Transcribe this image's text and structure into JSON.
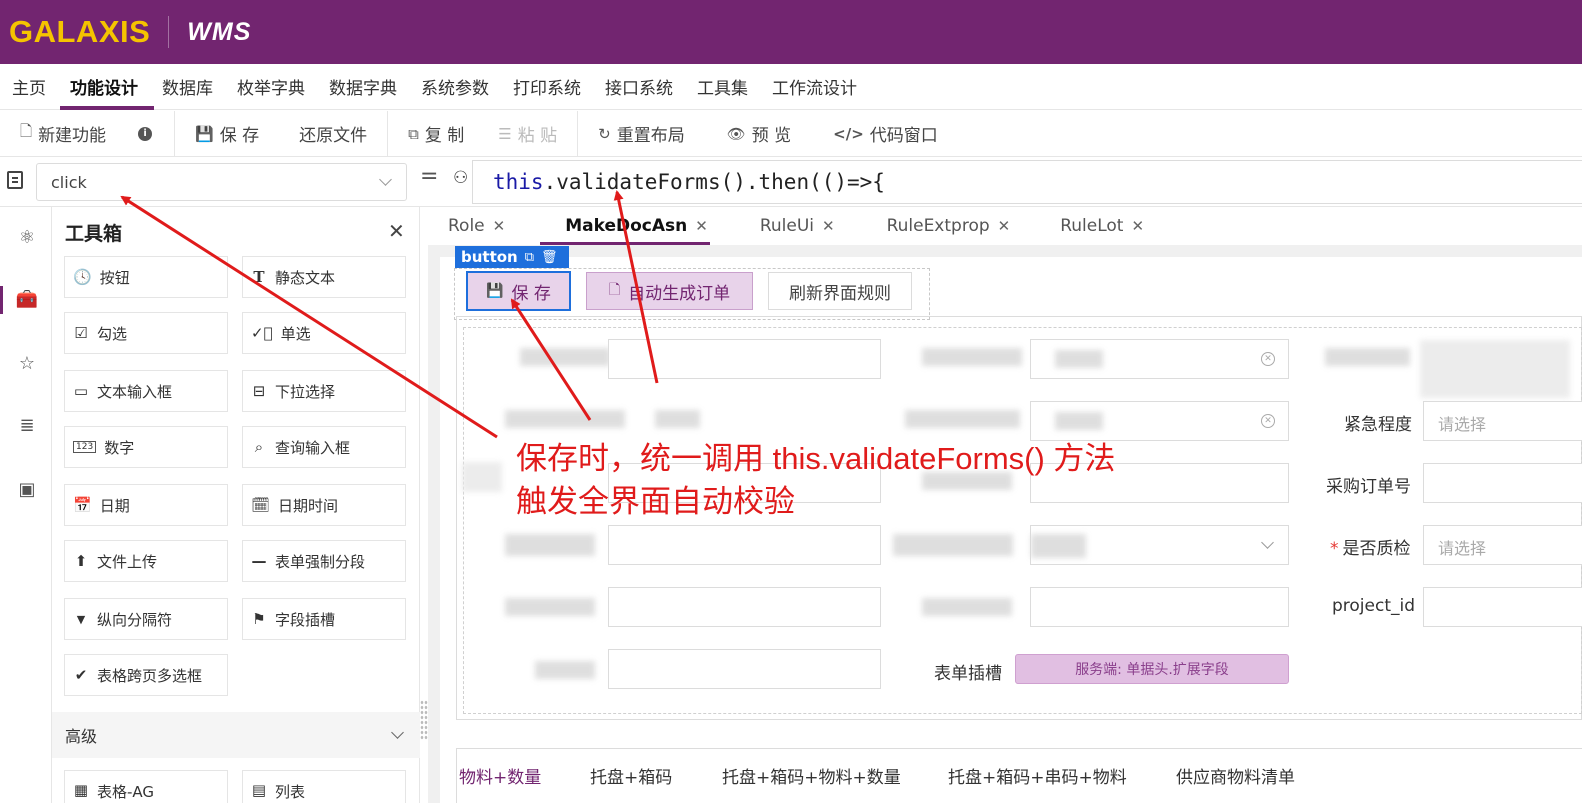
{
  "app": {
    "brand": "GALAXIS",
    "product": "WMS"
  },
  "menu": [
    {
      "label": "主页",
      "active": false
    },
    {
      "label": "功能设计",
      "active": true
    },
    {
      "label": "数据库",
      "active": false
    },
    {
      "label": "枚举字典",
      "active": false
    },
    {
      "label": "数据字典",
      "active": false
    },
    {
      "label": "系统参数",
      "active": false
    },
    {
      "label": "打印系统",
      "active": false
    },
    {
      "label": "接口系统",
      "active": false
    },
    {
      "label": "工具集",
      "active": false
    },
    {
      "label": "工作流设计",
      "active": false
    }
  ],
  "toolbar": {
    "new_function": "新建功能",
    "save": "保 存",
    "restore_file": "还原文件",
    "copy": "复 制",
    "paste": "粘 贴",
    "reset_layout": "重置布局",
    "preview": "预 览",
    "code_window": "代码窗口"
  },
  "event_bar": {
    "event_value": "click",
    "code_keyword": "this",
    "code_rest": ".validateForms().then(()=>{"
  },
  "toolbox": {
    "title": "工具箱",
    "widgets": [
      {
        "label": "按钮",
        "icon": "clock-icon"
      },
      {
        "label": "静态文本",
        "icon": "text-icon"
      },
      {
        "label": "勾选",
        "icon": "checkbox-icon"
      },
      {
        "label": "单选",
        "icon": "radio-icon"
      },
      {
        "label": "文本输入框",
        "icon": "text-input-icon"
      },
      {
        "label": "下拉选择",
        "icon": "select-icon"
      },
      {
        "label": "数字",
        "icon": "number-icon"
      },
      {
        "label": "查询输入框",
        "icon": "search-input-icon"
      },
      {
        "label": "日期",
        "icon": "calendar-icon"
      },
      {
        "label": "日期时间",
        "icon": "datetime-icon"
      },
      {
        "label": "文件上传",
        "icon": "upload-icon"
      },
      {
        "label": "表单强制分段",
        "icon": "dash-icon"
      },
      {
        "label": "纵向分隔符",
        "icon": "caret-down-icon"
      },
      {
        "label": "字段插槽",
        "icon": "flag-icon"
      },
      {
        "label": "表格跨页多选框",
        "icon": "double-check-icon"
      }
    ],
    "advanced_section": "高级",
    "advanced_widgets": [
      {
        "label": "表格-AG",
        "icon": "table-icon"
      },
      {
        "label": "列表",
        "icon": "list-icon"
      }
    ]
  },
  "tabs": [
    {
      "label": "Role",
      "active": false
    },
    {
      "label": "MakeDocAsn",
      "active": true
    },
    {
      "label": "RuleUi",
      "active": false
    },
    {
      "label": "RuleExtprop",
      "active": false
    },
    {
      "label": "RuleLot",
      "active": false
    }
  ],
  "designer": {
    "selected_label": "button",
    "buttons": {
      "save": "保 存",
      "auto_order": "自动生成订单",
      "refresh_rules": "刷新界面规则"
    },
    "fields": {
      "urgency": "紧急程度",
      "po_number": "采购订单号",
      "quality_check": "是否质检",
      "project_id": "project_id",
      "form_slot": "表单插槽",
      "placeholder_select": "请选择",
      "ext_slot_text": "服务端: 单据头.扩展字段"
    },
    "subtabs": [
      "物料+数量",
      "托盘+箱码",
      "托盘+箱码+物料+数量",
      "托盘+箱码+串码+物料",
      "供应商物料清单"
    ]
  },
  "annotation": {
    "line1": "保存时，统一调用 this.validateForms() 方法",
    "line2": "触发全界面自动校验"
  },
  "colors": {
    "brand_purple": "#722570",
    "brand_gold": "#f5c400",
    "selection_blue": "#1e6fdc",
    "annotation_red": "#e01b1b"
  }
}
